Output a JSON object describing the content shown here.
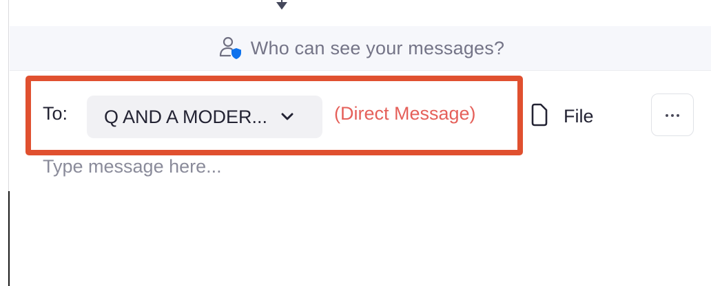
{
  "privacy": {
    "text": "Who can see your messages?",
    "icon": "person-shield-icon"
  },
  "recipient": {
    "to_label": "To:",
    "selected": "Q AND A MODER...",
    "dropdown_icon": "chevron-down-icon",
    "mode_label": "(Direct Message)"
  },
  "toolbar": {
    "file_label": "File",
    "file_icon": "file-icon",
    "more_icon": "more-icon"
  },
  "composer": {
    "placeholder": "Type message here..."
  },
  "colors": {
    "highlight_border": "#e0502f",
    "direct_message": "#e5605a",
    "accent_blue": "#0e72ed"
  }
}
